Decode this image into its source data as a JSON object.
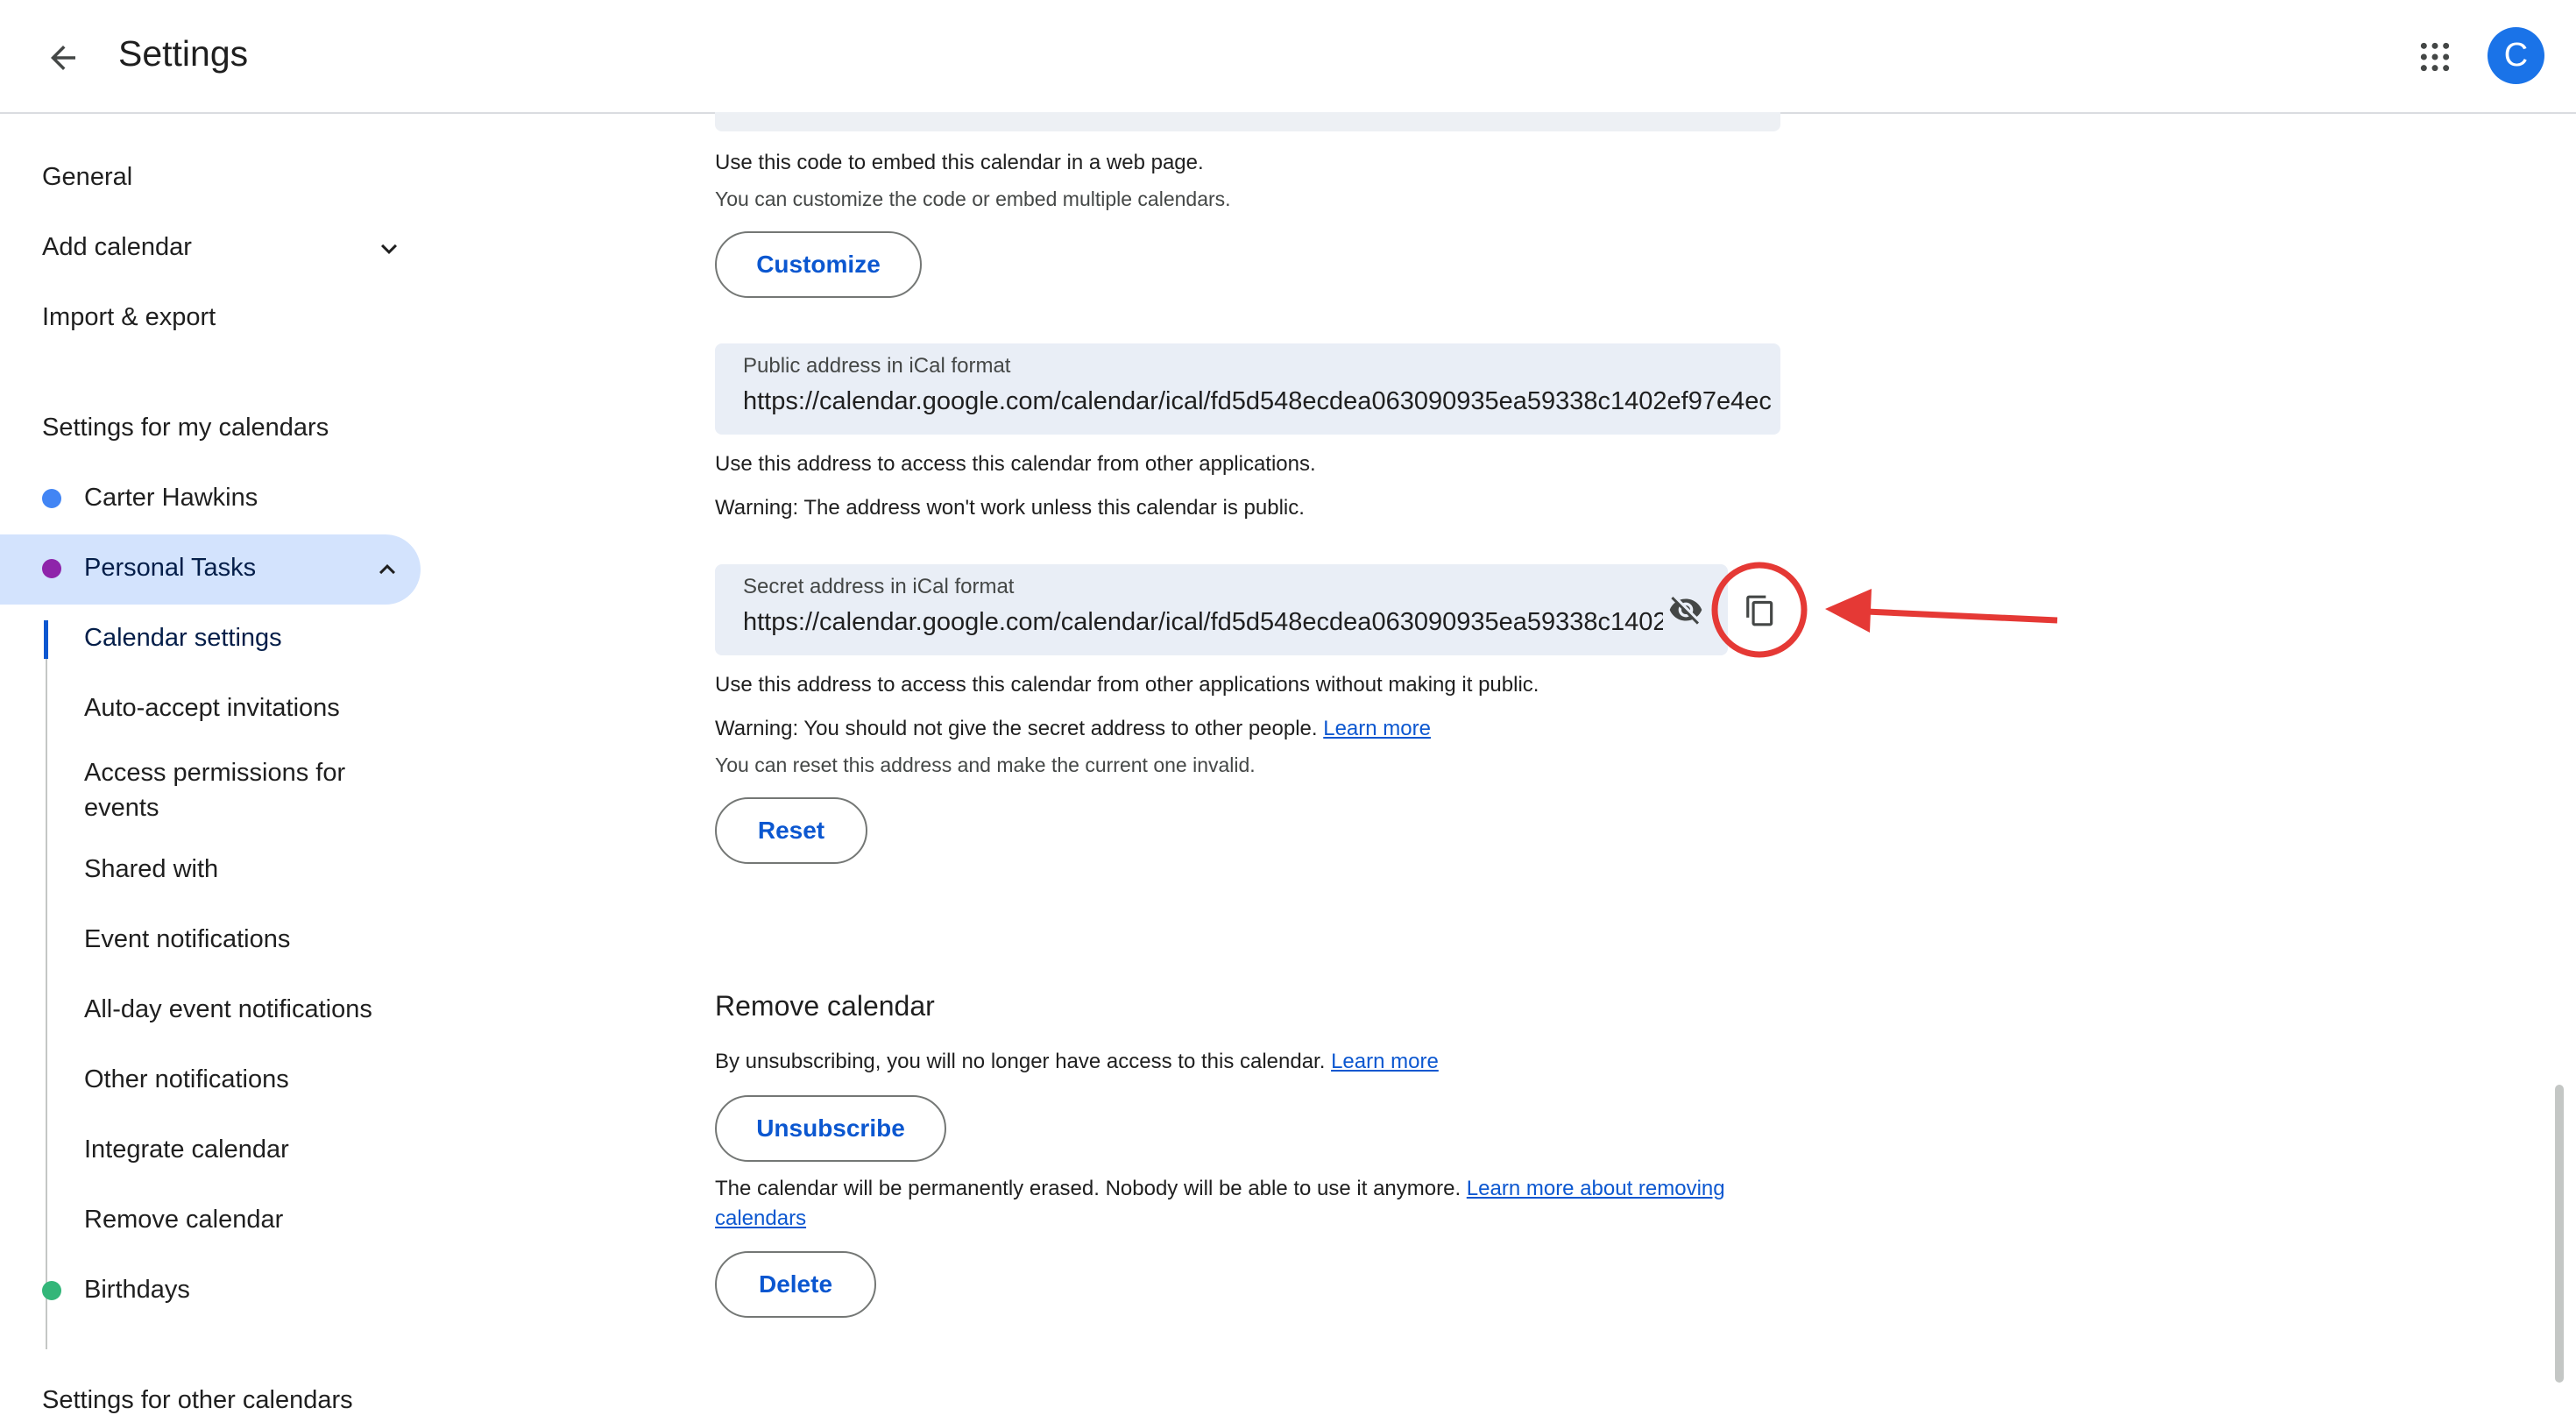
{
  "header": {
    "title": "Settings",
    "avatar_letter": "C"
  },
  "sidebar": {
    "general": "General",
    "add_calendar": "Add calendar",
    "import_export": "Import & export",
    "my_calendars_heading": "Settings for my calendars",
    "calendars": [
      {
        "label": "Carter Hawkins",
        "color": "#4285f4"
      },
      {
        "label": "Personal Tasks",
        "color": "#8e24aa"
      },
      {
        "label": "Birthdays",
        "color": "#33b679"
      }
    ],
    "sub_items": [
      "Calendar settings",
      "Auto-accept invitations",
      "Access permissions for events",
      "Shared with",
      "Event notifications",
      "All-day event notifications",
      "Other notifications",
      "Integrate calendar",
      "Remove calendar"
    ],
    "other_calendars_heading": "Settings for other calendars"
  },
  "embed": {
    "line1": "Use this code to embed this calendar in a web page.",
    "line2": "You can customize the code or embed multiple calendars.",
    "customize_label": "Customize"
  },
  "public_address": {
    "label": "Public address in iCal format",
    "value": "https://calendar.google.com/calendar/ical/fd5d548ecdea063090935ea59338c1402ef97e4ec",
    "help1": "Use this address to access this calendar from other applications.",
    "help2": "Warning: The address won't work unless this calendar is public."
  },
  "secret_address": {
    "label": "Secret address in iCal format",
    "value": "https://calendar.google.com/calendar/ical/fd5d548ecdea063090935ea59338c1402",
    "help1": "Use this address to access this calendar from other applications without making it public.",
    "warning": "Warning: You should not give the secret address to other people.",
    "learn_more": "Learn more",
    "reset_note": "You can reset this address and make the current one invalid.",
    "reset_label": "Reset"
  },
  "remove": {
    "title": "Remove calendar",
    "unsubscribe_text": "By unsubscribing, you will no longer have access to this calendar.",
    "learn_more": "Learn more",
    "unsubscribe_label": "Unsubscribe",
    "delete_text": "The calendar will be permanently erased. Nobody will be able to use it anymore.",
    "delete_link_1": "Learn more about removing",
    "delete_link_2": "calendars",
    "delete_label": "Delete"
  },
  "colors": {
    "accent": "#0b57d0",
    "annotation": "#e53935"
  }
}
